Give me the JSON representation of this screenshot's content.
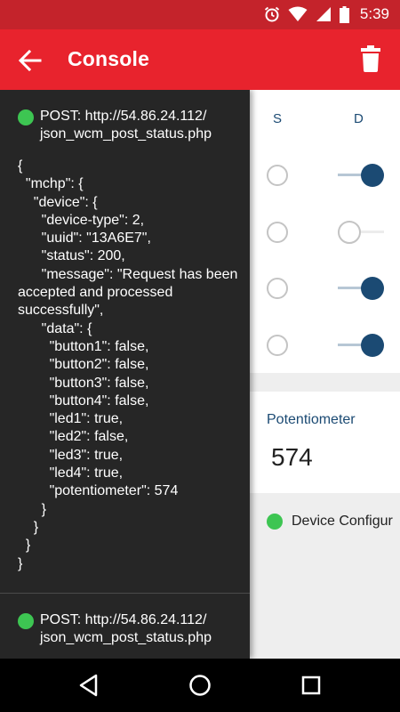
{
  "status_bar": {
    "time": "5:39",
    "icons": [
      "alarm-icon",
      "wifi-icon",
      "signal-icon",
      "battery-icon"
    ]
  },
  "app_bar": {
    "title": "Console",
    "back_icon": "arrow-left-icon",
    "action_icon": "trash-icon"
  },
  "console": {
    "entries": [
      {
        "url": "POST: http://54.86.24.112/\njson_wcm_post_status.php",
        "json": "{\n  \"mchp\": {\n    \"device\": {\n      \"device-type\": 2,\n      \"uuid\": \"13A6E7\",\n      \"status\": 200,\n      \"message\": \"Request has been accepted and processed successfully\",\n      \"data\": {\n        \"button1\": false,\n        \"button2\": false,\n        \"button3\": false,\n        \"button4\": false,\n        \"led1\": true,\n        \"led2\": false,\n        \"led3\": true,\n        \"led4\": true,\n        \"potentiometer\": 574\n      }\n    }\n  }\n}"
      },
      {
        "url": "POST: http://54.86.24.112/\njson_wcm_post_status.php"
      }
    ]
  },
  "main": {
    "columns": {
      "s": "S",
      "d": "D"
    },
    "rows": [
      {
        "s_checked": false,
        "d_on": true
      },
      {
        "s_checked": false,
        "d_on": false
      },
      {
        "s_checked": false,
        "d_on": true
      },
      {
        "s_checked": false,
        "d_on": true
      }
    ],
    "potentiometer": {
      "title": "Potentiometer",
      "value": "574"
    },
    "config": {
      "text": "Device Configur"
    }
  },
  "nav_bar": {
    "icons": [
      "back-triangle-icon",
      "home-circle-icon",
      "recents-square-icon"
    ]
  },
  "colors": {
    "app_bar": "#e8232d",
    "status_bar": "#c4232b",
    "console_bg": "#262626",
    "accent_navy": "#1b4a73",
    "status_green": "#3dc552"
  }
}
